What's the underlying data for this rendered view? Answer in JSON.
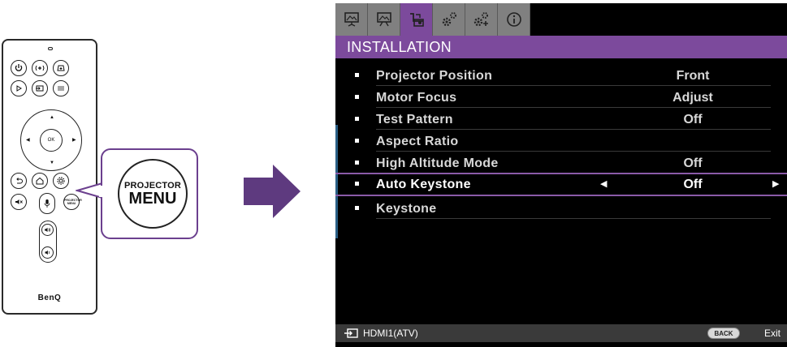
{
  "remote": {
    "brand": "BenQ",
    "ok_label": "OK",
    "projector_menu_label_small": "PROJECTOR MENU",
    "buttons": [
      "power-icon",
      "focus-plus-icon",
      "keystone-icon",
      "play-icon",
      "input-icon",
      "picture-mode-icon",
      "back-icon",
      "home-icon",
      "settings-icon",
      "mute-icon",
      "mic-icon",
      "volume-up-icon",
      "volume-down-icon"
    ]
  },
  "callout": {
    "line1": "PROJECTOR",
    "line2": "MENU",
    "border_color": "#6b3f8e"
  },
  "arrow": {
    "color": "#5e3a7f"
  },
  "osd": {
    "tabs": [
      {
        "icon": "display-picture-icon",
        "active": false
      },
      {
        "icon": "advanced-picture-icon",
        "active": false
      },
      {
        "icon": "installation-icon",
        "active": true
      },
      {
        "icon": "system-settings-icon",
        "active": false
      },
      {
        "icon": "system-advanced-icon",
        "active": false
      },
      {
        "icon": "information-icon",
        "active": false
      }
    ],
    "section_title": "INSTALLATION",
    "items": [
      {
        "label": "Projector Position",
        "value": "Front"
      },
      {
        "label": "Motor Focus",
        "value": "Adjust"
      },
      {
        "label": "Test Pattern",
        "value": "Off"
      },
      {
        "label": "Aspect Ratio",
        "value": ""
      },
      {
        "label": "High Altitude Mode",
        "value": "Off"
      },
      {
        "label": "Auto Keystone",
        "value": "Off",
        "selected": true
      },
      {
        "label": "Keystone",
        "value": ""
      }
    ],
    "status": {
      "source": "HDMI1(ATV)",
      "back_key": "BACK",
      "exit": "Exit"
    },
    "accent_color": "#7c4a9c"
  }
}
